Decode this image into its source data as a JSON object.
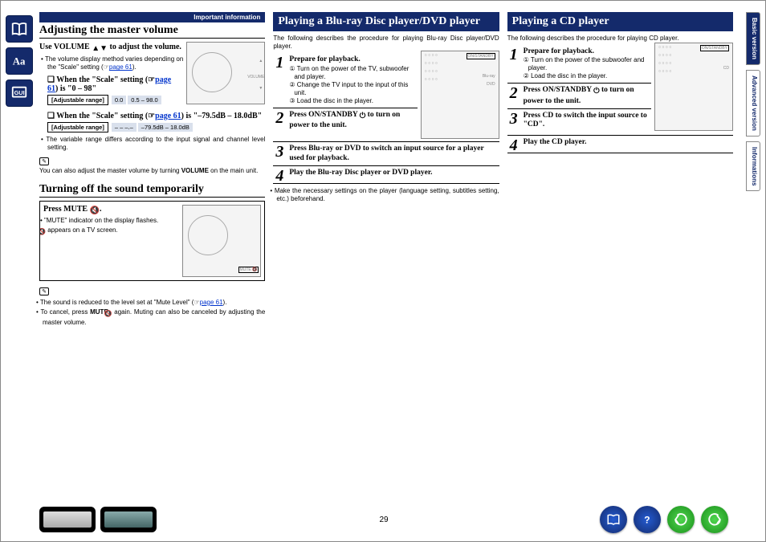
{
  "info_bar": "Important information",
  "page_number": "29",
  "sidebar_tabs": {
    "t1": "Basic version",
    "t2": "Advanced version",
    "t3": "Informations"
  },
  "col1": {
    "h1": "Adjusting the master volume",
    "use_pre": "Use ",
    "use_vol": "VOLUME",
    "use_post": " to adjust the volume.",
    "b1_pre": "The volume display method varies depending on the \"Scale\" setting (",
    "b1_link": "page 61",
    "b1_post": ").",
    "sub1_pre": "When the \"Scale\" setting (",
    "sub1_link": "page 61",
    "sub1_post": ") is \"0 – 98\"",
    "range_lbl": "[Adjustable range]",
    "r1a": "0.0",
    "r1b": "0.5 – 98.0",
    "sub2_pre": "When the \"Scale\" setting (",
    "sub2_link": "page 61",
    "sub2_post": ") is \"–79.5dB – 18.0dB\"",
    "r2a": "– – –.–",
    "r2b": "–79.5dB – 18.0dB",
    "b2": "The variable range differs according to the input signal and channel level setting.",
    "note1_pre": "You can also adjust the master volume by turning ",
    "note1_bold": "VOLUME",
    "note1_post": " on the main unit.",
    "h2": "Turning off the sound temporarily",
    "press_mute_pre": "Press ",
    "press_mute_bold": "MUTE ",
    "press_mute_post": ".",
    "mb1": "\"MUTE\" indicator on the display flashes.",
    "mb2": " appears on a TV screen.",
    "note2_pre": "The sound is reduced to the level set at \"Mute Level\" (",
    "note2_link": "page 61",
    "note2_post": ").",
    "note3a": "To cancel, press ",
    "note3b": "MUTE ",
    "note3c": " again. Muting can also be canceled by adjusting the master volume."
  },
  "col2": {
    "h": "Playing a Blu-ray Disc player/DVD player",
    "intro": "The following describes the procedure for playing Blu-ray Disc player/DVD player.",
    "s1t": "Prepare for playback.",
    "s1a": "Turn on the power of the TV, subwoofer and player.",
    "s1b": "Change the TV input to the input of this unit.",
    "s1c": "Load the disc in the player.",
    "s2_pre": "Press ",
    "s2_bold": "ON/STANDBY ",
    "s2_post": " to turn on power to the unit.",
    "s3a": "Press ",
    "s3b": "Blu-ray",
    "s3c": " or ",
    "s3d": "DVD",
    "s3e": " to switch an input source for a player used for playback.",
    "s4": "Play the Blu-ray Disc player or DVD player.",
    "foot": "Make the necessary settings on the player (language setting, subtitles setting, etc.) beforehand."
  },
  "col3": {
    "h": "Playing a CD player",
    "intro": "The following describes the procedure for playing CD player.",
    "s1t": "Prepare for playback.",
    "s1a": "Turn on the power of the subwoofer and player.",
    "s1b": "Load the disc in the player.",
    "s2_pre": "Press ",
    "s2_bold": "ON/STANDBY ",
    "s2_post": " to turn on power to the unit.",
    "s3a": "Press ",
    "s3b": "CD",
    "s3c": " to switch the input source to \"CD\".",
    "s4": "Play the CD player."
  }
}
